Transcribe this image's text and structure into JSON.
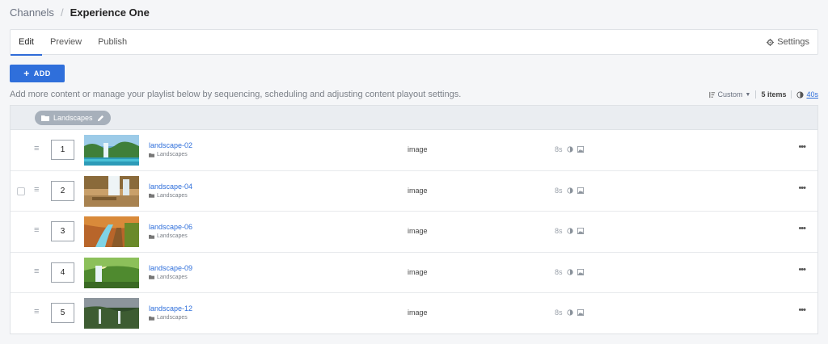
{
  "breadcrumb": {
    "parent": "Channels",
    "separator": "/",
    "current": "Experience One"
  },
  "tabs": [
    {
      "label": "Edit",
      "active": true
    },
    {
      "label": "Preview"
    },
    {
      "label": "Publish"
    }
  ],
  "settings_label": "Settings",
  "add_button": {
    "label": "ADD"
  },
  "helptext": "Add more content or manage your playlist below by sequencing, scheduling and adjusting content playout settings.",
  "toolbar": {
    "sort_label": "Custom",
    "items_count": "5 items",
    "total_duration": "40s"
  },
  "group": {
    "label": "Landscapes"
  },
  "rows": [
    {
      "index": "1",
      "title": "landscape-02",
      "folder": "Landscapes",
      "type": "image",
      "duration": "8s"
    },
    {
      "index": "2",
      "title": "landscape-04",
      "folder": "Landscapes",
      "type": "image",
      "duration": "8s"
    },
    {
      "index": "3",
      "title": "landscape-06",
      "folder": "Landscapes",
      "type": "image",
      "duration": "8s"
    },
    {
      "index": "4",
      "title": "landscape-09",
      "folder": "Landscapes",
      "type": "image",
      "duration": "8s"
    },
    {
      "index": "5",
      "title": "landscape-12",
      "folder": "Landscapes",
      "type": "image",
      "duration": "8s"
    }
  ],
  "colors": {
    "accent": "#2f6fdb",
    "chip": "#a7b0bb"
  },
  "icons": {
    "settings": "gear-icon",
    "sort": "sort-icon",
    "folder": "folder-icon",
    "edit": "pencil-icon",
    "contrast": "contrast-icon",
    "image": "image-icon",
    "drag": "drag-handle-icon",
    "more": "more-icon"
  }
}
